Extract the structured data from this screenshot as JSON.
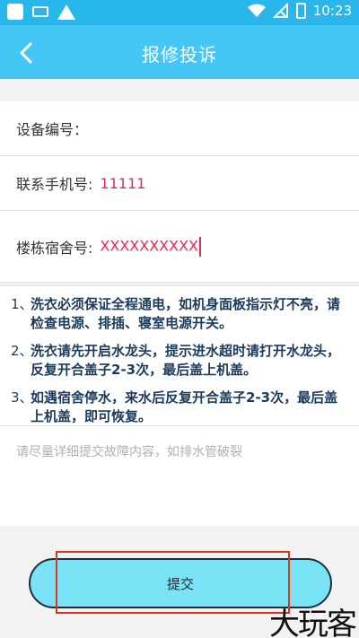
{
  "status_bar": {
    "time": "10:23",
    "icons": [
      "square-icon",
      "keyboard-icon",
      "warning-icon",
      "wifi-icon",
      "no-signal-icon",
      "battery-charging-icon"
    ]
  },
  "header": {
    "title": "报修投诉",
    "back_icon": "chevron-left-icon"
  },
  "form": {
    "device_no_label": "设备编号：",
    "device_no_value": "",
    "phone_label": "联系手机号:",
    "phone_value": "11111",
    "dorm_label": "楼栋宿舍号:",
    "dorm_value": "XXXXXXXXXX"
  },
  "notes": [
    {
      "num": "1、",
      "text": "洗衣必须保证全程通电，如机身面板指示灯不亮，请检查电源、排插、寝室电源开关。"
    },
    {
      "num": "2、",
      "text": "洗衣请先开启水龙头，提示进水超时请打开水龙头，反复开合盖子2-3次，最后盖上机盖。"
    },
    {
      "num": "3、",
      "text": "如遇宿舍停水，来水后反复开合盖子2-3次，最后盖上机盖，即可恢复。"
    }
  ],
  "description": {
    "placeholder": "请尽量详细提交故障内容，如排水管破裂"
  },
  "submit": {
    "label": "提交"
  },
  "watermark": {
    "text": "大玩客"
  },
  "colors": {
    "status_bar": "#29b6ea",
    "nav_bar": "#44c7f5",
    "accent_text": "#e8294f",
    "submit_bg": "#79e3f5",
    "highlight": "#e0301e"
  }
}
